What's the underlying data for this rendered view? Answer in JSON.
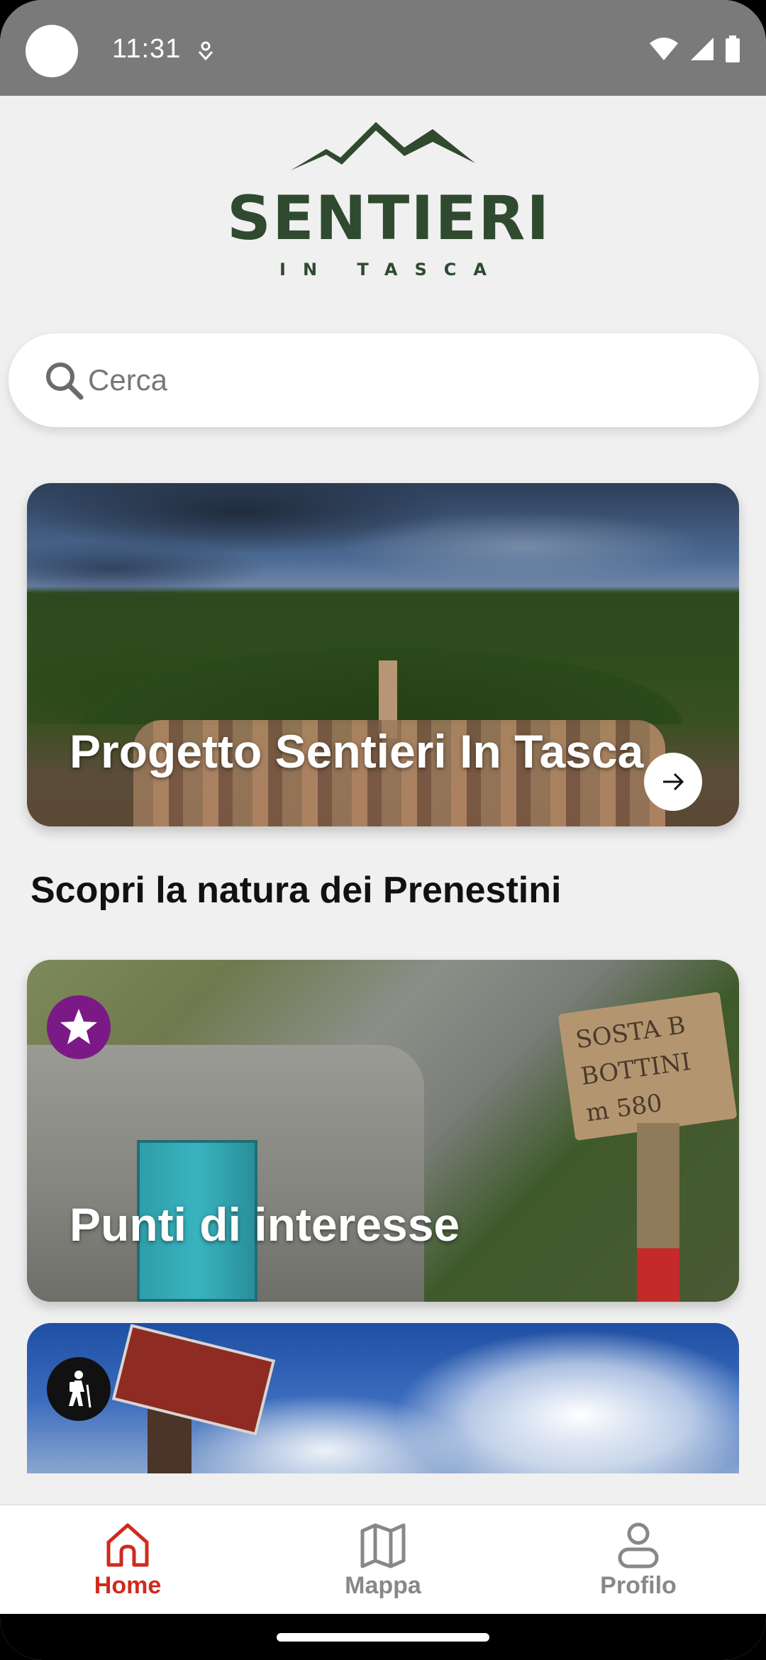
{
  "status_bar": {
    "time": "11:31"
  },
  "logo": {
    "word": "SENTIERI",
    "sub": "IN TASCA"
  },
  "search": {
    "placeholder": "Cerca",
    "value": ""
  },
  "hero_card": {
    "title": "Progetto Sentieri In Tasca"
  },
  "section": {
    "title": "Scopri la natura dei Prenestini"
  },
  "poi_card": {
    "title": "Punti di interesse",
    "sign_text": [
      "SOSTA B",
      "BOTTINI",
      "m 580"
    ],
    "badge_color": "#7b1a86"
  },
  "bottom_nav": {
    "items": [
      {
        "label": "Home",
        "icon": "home-icon",
        "active": true
      },
      {
        "label": "Mappa",
        "icon": "map-icon",
        "active": false
      },
      {
        "label": "Profilo",
        "icon": "profile-icon",
        "active": false
      }
    ],
    "active_color": "#d02a1e"
  },
  "colors": {
    "brand_green": "#2f4a2e",
    "accent_red": "#d02a1e"
  }
}
